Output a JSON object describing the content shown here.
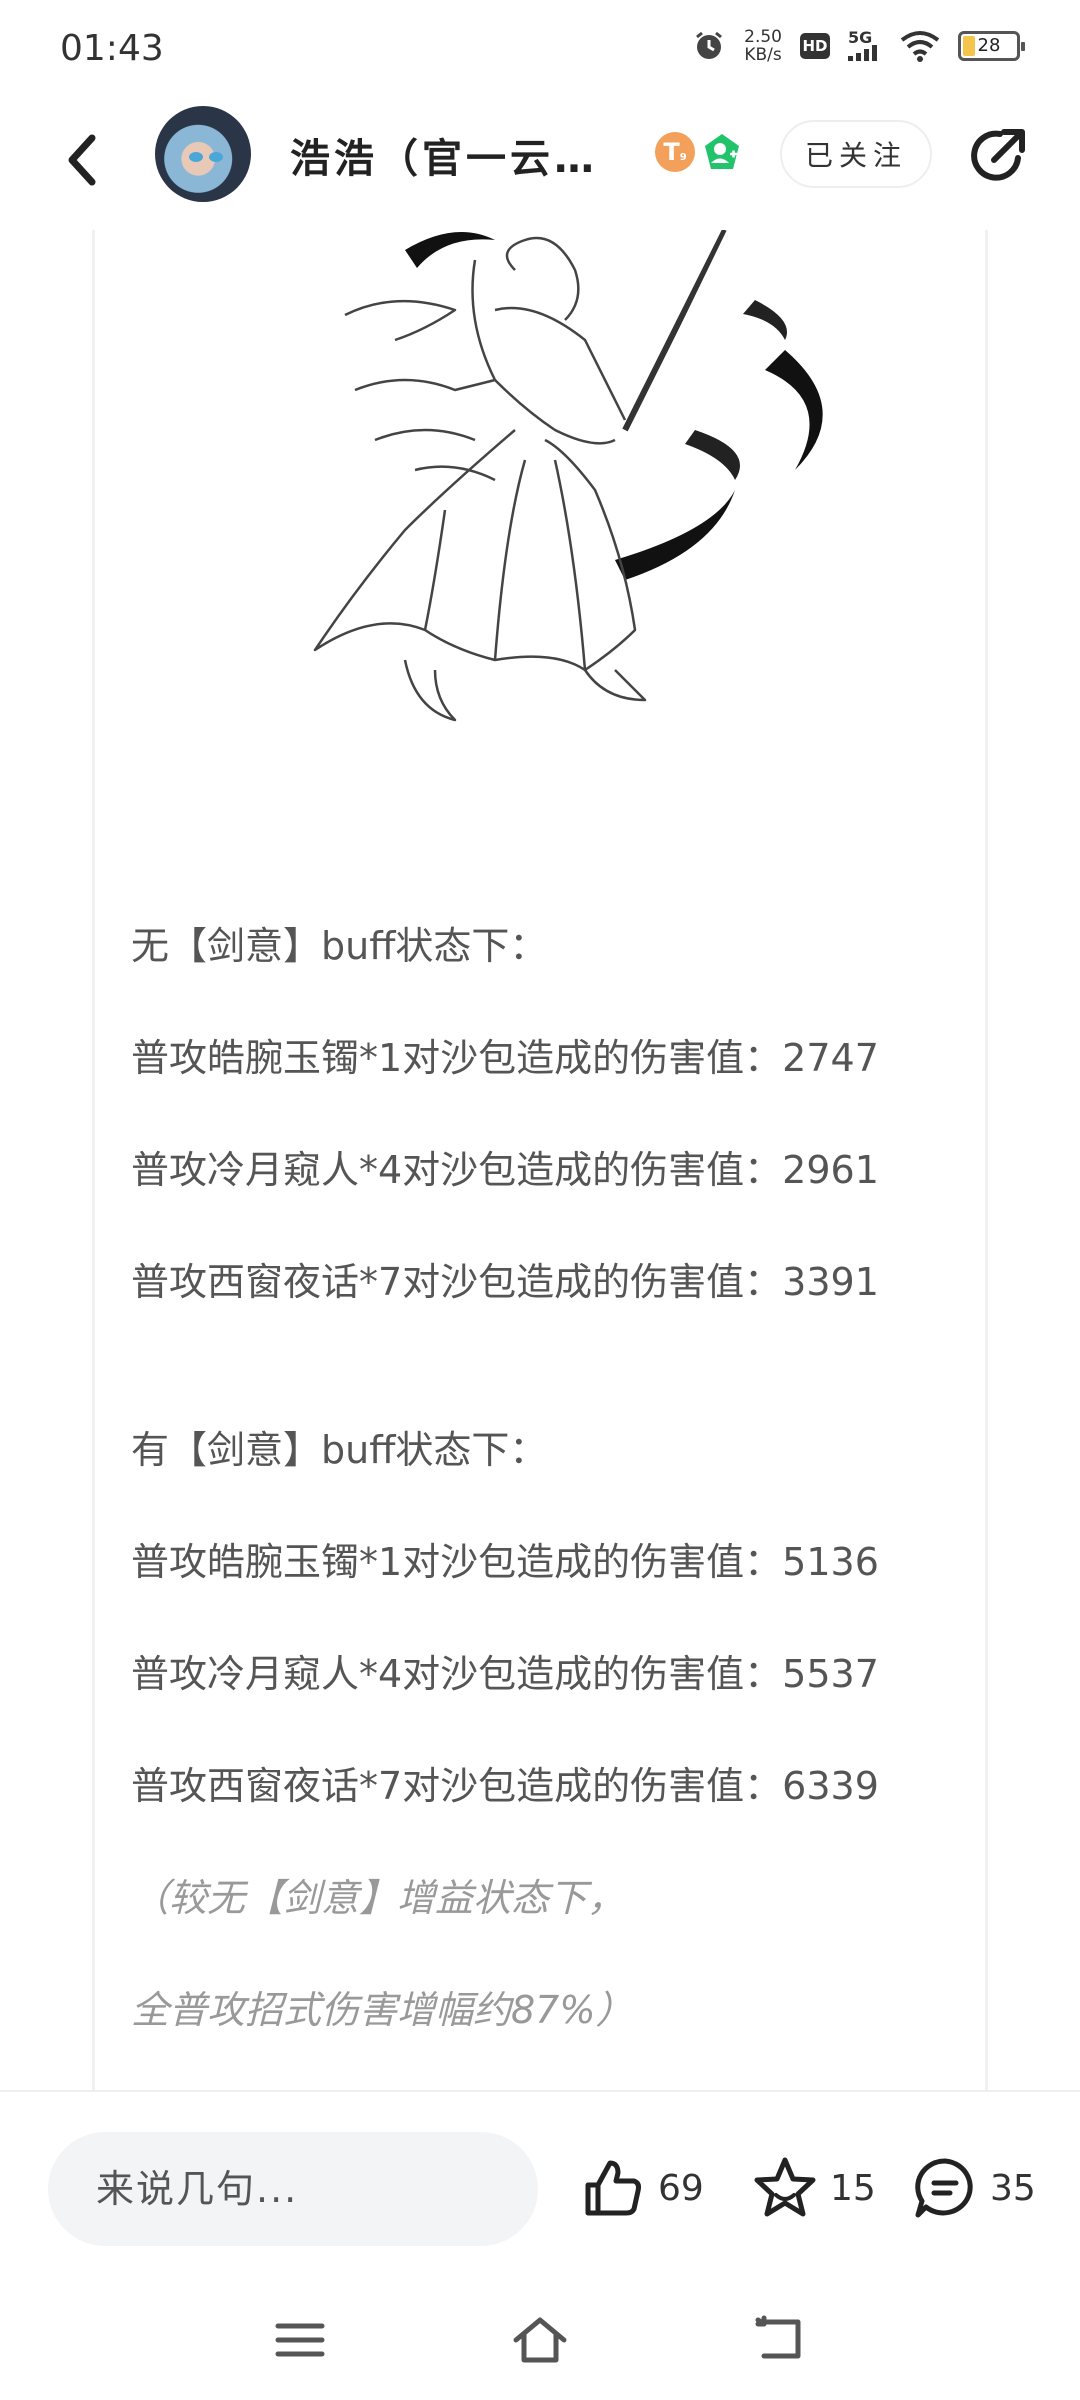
{
  "status_bar": {
    "time": "01:43",
    "net_speed_value": "2.50",
    "net_speed_unit": "KB/s",
    "hd_label": "HD",
    "signal_label": "5G",
    "battery_level": "28",
    "battery_fraction": 0.28
  },
  "header": {
    "username": "浩浩（官一云…",
    "level_badge": "T",
    "level_sub": "9",
    "follow_label": "已关注"
  },
  "post": {
    "lines": [
      "无【剑意】buff状态下：",
      "普攻皓腕玉镯*1对沙包造成的伤害值：2747",
      "普攻冷月窥人*4对沙包造成的伤害值：2961",
      "普攻西窗夜话*7对沙包造成的伤害值：3391",
      "有【剑意】buff状态下：",
      "普攻皓腕玉镯*1对沙包造成的伤害值：5136",
      "普攻冷月窥人*4对沙包造成的伤害值：5537",
      "普攻西窗夜话*7对沙包造成的伤害值：6339",
      "（较无【剑意】增益状态下，",
      "全普攻招式伤害增幅约87%）"
    ]
  },
  "bottom_bar": {
    "comment_placeholder": "来说几句...",
    "likes": "69",
    "favorites": "15",
    "comments": "35"
  },
  "colors": {
    "page_bg": "#ffffff",
    "text": "#555555",
    "note_text": "#999999",
    "input_bg": "#f3f4f6",
    "badge_orange": "#f2a05a",
    "badge_green": "#21c36b",
    "battery_fill": "#f3c54a"
  },
  "icons": [
    "back-icon",
    "share-icon",
    "like-icon",
    "star-icon",
    "comment-icon",
    "menu-icon",
    "home-icon",
    "return-icon",
    "alarm-icon",
    "wifi-icon"
  ]
}
